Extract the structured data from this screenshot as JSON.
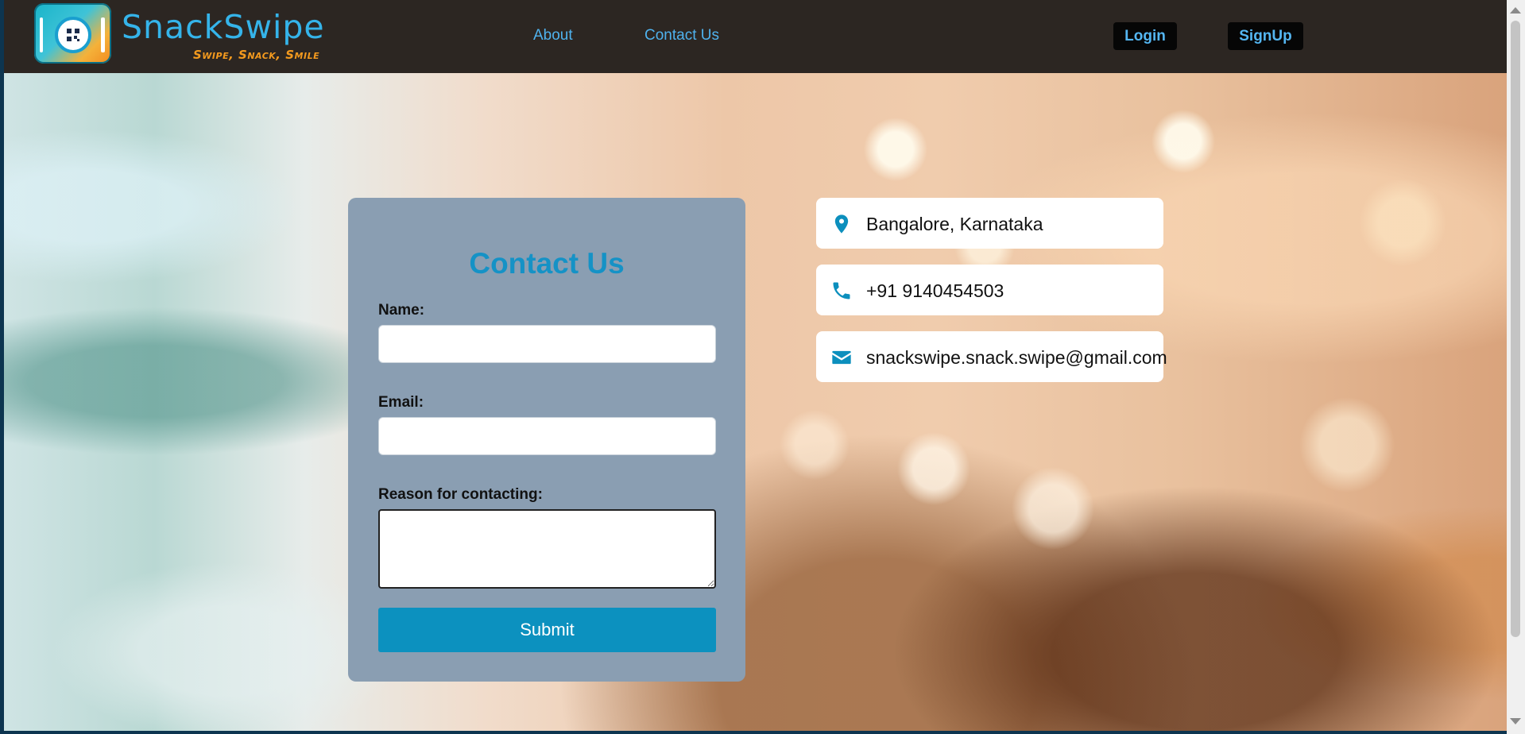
{
  "brand": {
    "name": "SnackSwipe",
    "tagline": "Swipe, Snack, Smile"
  },
  "nav": {
    "links": [
      {
        "label": "About"
      },
      {
        "label": "Contact Us"
      }
    ],
    "login_label": "Login",
    "signup_label": "SignUp"
  },
  "form": {
    "title": "Contact Us",
    "name_label": "Name:",
    "name_value": "",
    "email_label": "Email:",
    "email_value": "",
    "reason_label": "Reason for contacting:",
    "reason_value": "",
    "submit_label": "Submit"
  },
  "contact_info": [
    {
      "icon": "location-pin-icon",
      "text": "Bangalore, Karnataka"
    },
    {
      "icon": "phone-icon",
      "text": "+91 9140454503"
    },
    {
      "icon": "envelope-icon",
      "text": "snackswipe.snack.swipe@gmail.com"
    }
  ],
  "colors": {
    "accent": "#1592c6",
    "nav_link": "#4fb2ee",
    "navbar_bg": "#2c2622",
    "card_bg": "#8a9eb2",
    "submit_bg": "#0c91bf"
  }
}
